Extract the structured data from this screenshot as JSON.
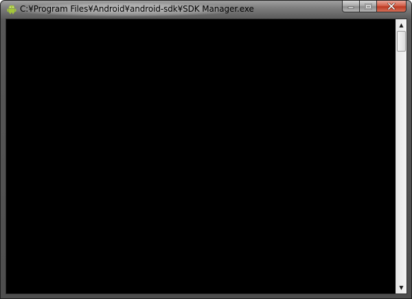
{
  "window": {
    "title": "C:¥Program Files¥Android¥android-sdk¥SDK Manager.exe",
    "app_icon": "android-icon",
    "caption_buttons": {
      "minimize_icon": "minimize-icon",
      "maximize_icon": "maximize-icon",
      "close_icon": "close-icon"
    }
  },
  "console": {
    "background_color": "#000000",
    "text_color": "#c0c0c0",
    "lines": []
  },
  "scrollbar": {
    "up_arrow": "▲",
    "down_arrow": "▼"
  },
  "colors": {
    "frame": "#575757",
    "close_button": "#c9452c",
    "android_green": "#a4c639"
  }
}
